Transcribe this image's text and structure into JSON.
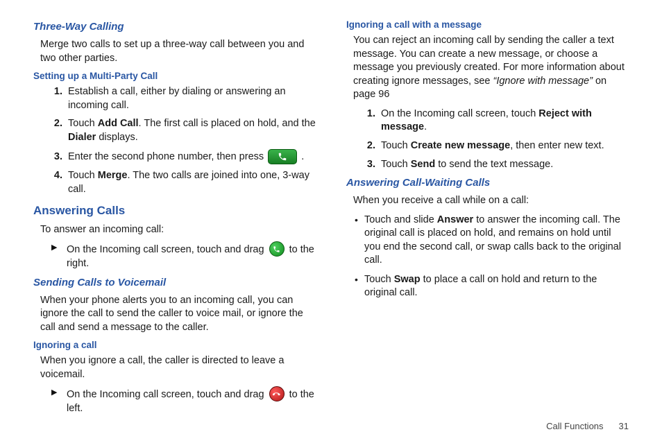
{
  "left": {
    "h1": "Three-Way Calling",
    "p1": "Merge two calls to set up a three-way call between you and two other parties.",
    "h2": "Setting up a Multi-Party Call",
    "ol1": {
      "i1": "Establish a call, either by dialing or answering an incoming call.",
      "i2a": "Touch ",
      "i2b": "Add Call",
      "i2c": ". The first call is placed on hold, and the ",
      "i2d": "Dialer",
      "i2e": " displays.",
      "i3a": "Enter the second phone number, then press ",
      "i3b": ".",
      "i4a": "Touch ",
      "i4b": "Merge",
      "i4c": ". The two calls are joined into one, 3-way call."
    },
    "h3": "Answering Calls",
    "p2": "To answer an incoming call:",
    "arrow1a": "On the Incoming call screen, touch and drag ",
    "arrow1b": " to the right.",
    "h4": "Sending Calls to Voicemail",
    "p3": "When your phone alerts you to an incoming call, you can ignore the call to send the caller to voice mail, or ignore the call and send a message to the caller.",
    "h5": "Ignoring a call",
    "p4": "When you ignore a call, the caller is directed to leave a voicemail.",
    "arrow2a": "On the Incoming call screen, touch and drag ",
    "arrow2b": " to the left."
  },
  "right": {
    "h1": "Ignoring a call with a message",
    "p1a": "You can reject an incoming call by sending the caller a text message. You can create a new message, or choose a message you previously created. For more information about creating ignore messages, see ",
    "p1b": "“Ignore with message”",
    "p1c": " on page 96",
    "ol1": {
      "i1a": "On the Incoming call screen, touch ",
      "i1b": "Reject with message",
      "i1c": ".",
      "i2a": "Touch ",
      "i2b": "Create new message",
      "i2c": ", then enter new text.",
      "i3a": "Touch ",
      "i3b": "Send",
      "i3c": " to send the text message."
    },
    "h2": "Answering Call-Waiting Calls",
    "p2": "When you receive a call while on a call:",
    "bul": {
      "b1a": "Touch and slide ",
      "b1b": "Answer",
      "b1c": " to answer the incoming call. The original call is placed on hold, and remains on hold until you end the second call, or swap calls back to the original call.",
      "b2a": "Touch ",
      "b2b": "Swap",
      "b2c": " to place a call on hold and return to the original call."
    }
  },
  "footer": {
    "section": "Call Functions",
    "page": "31"
  }
}
